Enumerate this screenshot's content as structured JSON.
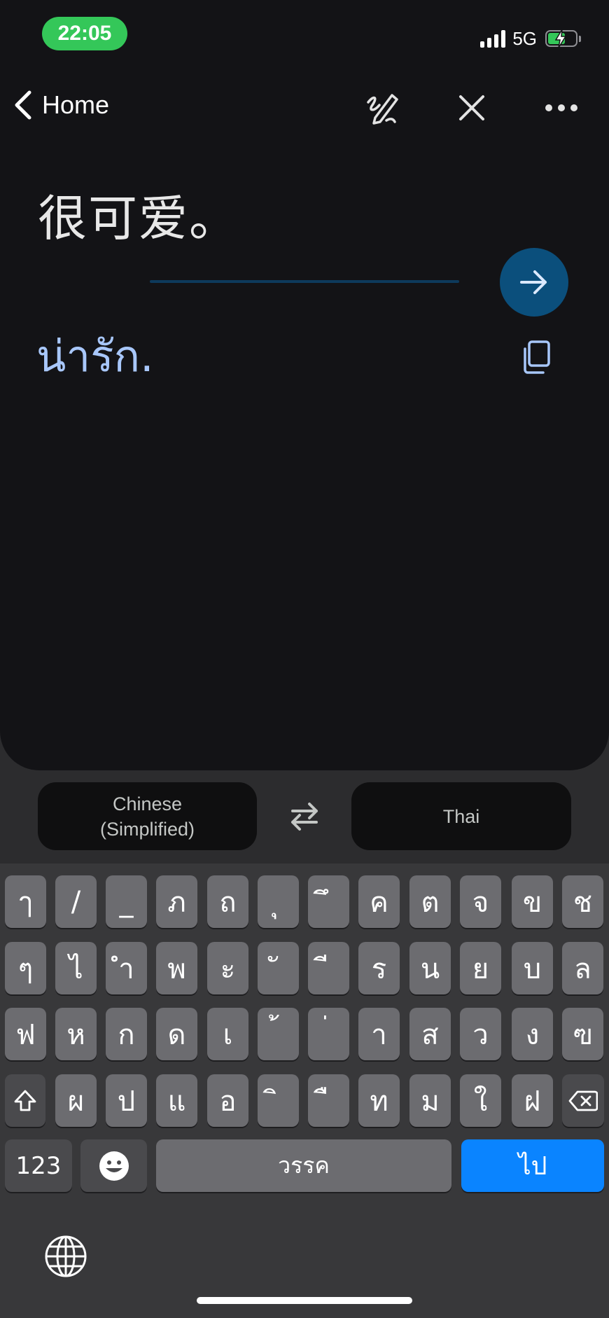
{
  "status_bar": {
    "time": "22:05",
    "network": "5G"
  },
  "nav": {
    "back_label": "Home",
    "icons": [
      "handwriting-icon",
      "close-icon",
      "more-icon"
    ]
  },
  "translation": {
    "source_text": "很可爱。",
    "translated_text": "น่ารัก."
  },
  "languages": {
    "source_line1": "Chinese",
    "source_line2": "(Simplified)",
    "target": "Thai"
  },
  "keyboard": {
    "row1": [
      "ๅ",
      "/",
      "_",
      "ภ",
      "ถ",
      "ุ",
      "ึ",
      "ค",
      "ต",
      "จ",
      "ข",
      "ช"
    ],
    "row2": [
      "ๆ",
      "ไ",
      "ำ",
      "พ",
      "ะ",
      "ั",
      "ี",
      "ร",
      "น",
      "ย",
      "บ",
      "ล"
    ],
    "row3": [
      "ฟ",
      "ห",
      "ก",
      "ด",
      "เ",
      "้",
      "่",
      "า",
      "ส",
      "ว",
      "ง",
      "ฃ"
    ],
    "row4": [
      "ผ",
      "ป",
      "แ",
      "อ",
      "ิ",
      "ื",
      "ท",
      "ม",
      "ใ",
      "ฝ"
    ],
    "numbers_label": "123",
    "space_label": "วรรค",
    "go_label": "ไป"
  },
  "colors": {
    "accent": "#a8c7fa",
    "go_button": "#0b4f7c",
    "keyboard_return": "#0a84ff",
    "time_pill": "#34c759"
  }
}
